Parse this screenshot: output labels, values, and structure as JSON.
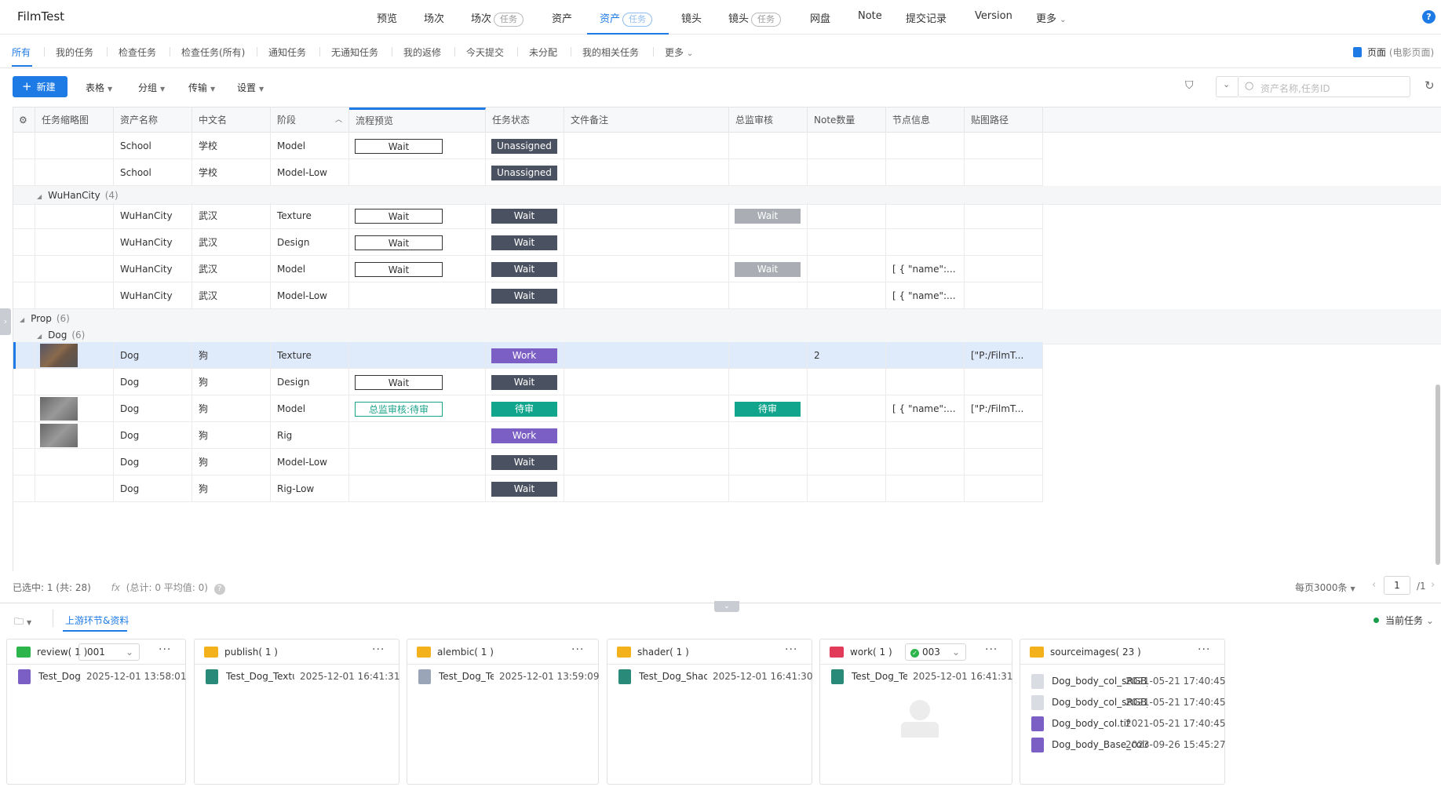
{
  "app_title": "FilmTest",
  "nav": [
    {
      "label": "预览",
      "pill": ""
    },
    {
      "label": "场次",
      "pill": ""
    },
    {
      "label": "场次",
      "pill": "任务"
    },
    {
      "label": "资产",
      "pill": ""
    },
    {
      "label": "资产",
      "pill": "任务"
    },
    {
      "label": "镜头",
      "pill": ""
    },
    {
      "label": "镜头",
      "pill": "任务"
    },
    {
      "label": "网盘",
      "pill": ""
    },
    {
      "label": "Note",
      "pill": ""
    },
    {
      "label": "提交记录",
      "pill": ""
    },
    {
      "label": "Version",
      "pill": ""
    },
    {
      "label": "更多",
      "pill": ""
    }
  ],
  "subtabs": [
    "所有",
    "我的任务",
    "检查任务",
    "检查任务(所有)",
    "通知任务",
    "无通知任务",
    "我的返修",
    "今天提交",
    "未分配",
    "我的相关任务",
    "更多"
  ],
  "page_label": "页面",
  "page_context": "(电影页面)",
  "toolbar": {
    "new_label": "新建",
    "menus": [
      "表格",
      "分组",
      "传输",
      "设置"
    ],
    "search_placeholder": "资产名称,任务ID"
  },
  "columns": [
    "任务缩略图",
    "资产名称",
    "中文名",
    "阶段",
    "流程预览",
    "任务状态",
    "文件备注",
    "总监审核",
    "Note数量",
    "节点信息",
    "贴图路径"
  ],
  "school_rows": [
    {
      "asset": "School",
      "cn": "学校",
      "stage": "Model",
      "flow": "Wait",
      "status": "Unassigned",
      "review": "",
      "notes": "",
      "node": "",
      "path": ""
    },
    {
      "asset": "School",
      "cn": "学校",
      "stage": "Model-Low",
      "flow": "",
      "status": "Unassigned",
      "review": "",
      "notes": "",
      "node": "",
      "path": ""
    }
  ],
  "group_wuhan": {
    "name": "WuHanCity",
    "count": "(4)"
  },
  "wuhan_rows": [
    {
      "asset": "WuHanCity",
      "cn": "武汉",
      "stage": "Texture",
      "flow": "Wait",
      "status": "Wait",
      "review": "Wait",
      "notes": "",
      "node": "",
      "path": ""
    },
    {
      "asset": "WuHanCity",
      "cn": "武汉",
      "stage": "Design",
      "flow": "Wait",
      "status": "Wait",
      "review": "",
      "notes": "",
      "node": "",
      "path": ""
    },
    {
      "asset": "WuHanCity",
      "cn": "武汉",
      "stage": "Model",
      "flow": "Wait",
      "status": "Wait",
      "review": "Wait",
      "notes": "",
      "node": "[ { \"name\":...",
      "path": ""
    },
    {
      "asset": "WuHanCity",
      "cn": "武汉",
      "stage": "Model-Low",
      "flow": "",
      "status": "Wait",
      "review": "",
      "notes": "",
      "node": "[ { \"name\":...",
      "path": ""
    }
  ],
  "group_prop": {
    "name": "Prop",
    "count": "(6)"
  },
  "group_dog": {
    "name": "Dog",
    "count": "(6)"
  },
  "dog_rows": [
    {
      "asset": "Dog",
      "cn": "狗",
      "stage": "Texture",
      "flow": "",
      "status": "Work",
      "review": "",
      "notes": "2",
      "node": "",
      "path": "[\"P:/FilmT..."
    },
    {
      "asset": "Dog",
      "cn": "狗",
      "stage": "Design",
      "flow": "Wait",
      "status": "Wait",
      "review": "",
      "notes": "",
      "node": "",
      "path": ""
    },
    {
      "asset": "Dog",
      "cn": "狗",
      "stage": "Model",
      "flow": "总监审核:待审",
      "status": "待审",
      "review": "待审",
      "notes": "",
      "node": "[ { \"name\":...",
      "path": "[\"P:/FilmT..."
    },
    {
      "asset": "Dog",
      "cn": "狗",
      "stage": "Rig",
      "flow": "",
      "status": "Work",
      "review": "",
      "notes": "",
      "node": "",
      "path": ""
    },
    {
      "asset": "Dog",
      "cn": "狗",
      "stage": "Model-Low",
      "flow": "",
      "status": "Wait",
      "review": "",
      "notes": "",
      "node": "",
      "path": ""
    },
    {
      "asset": "Dog",
      "cn": "狗",
      "stage": "Rig-Low",
      "flow": "",
      "status": "Wait",
      "review": "",
      "notes": "",
      "node": "",
      "path": ""
    }
  ],
  "status_bar": {
    "selected": "已选中: 1 (共: 28)",
    "formula": "(总计: 0 平均值: 0)"
  },
  "pagination": {
    "page_size": "每页3000条",
    "page": "1",
    "total": "/1"
  },
  "bottom": {
    "tab_label": "上游环节&资料",
    "current_task": "当前任务",
    "cards": [
      {
        "title": "review( 1 )",
        "dropdown": "001",
        "files": [
          {
            "name": "Test_Dog_Te...",
            "date": "2025-12-01 13:58:01"
          }
        ]
      },
      {
        "title": "publish( 1 )",
        "dropdown": "",
        "files": [
          {
            "name": "Test_Dog_Texture.ma",
            "date": "2025-12-01 16:41:31"
          }
        ]
      },
      {
        "title": "alembic( 1 )",
        "dropdown": "",
        "files": [
          {
            "name": "Test_Dog_Textu...",
            "date": "2025-12-01 13:59:09"
          }
        ]
      },
      {
        "title": "shader( 1 )",
        "dropdown": "",
        "files": [
          {
            "name": "Test_Dog_Shader.ma",
            "date": "2025-12-01 16:41:30"
          }
        ]
      },
      {
        "title": "work( 1 )",
        "dropdown": "003",
        "files": [
          {
            "name": "Test_Dog_Textu...",
            "date": "2025-12-01 16:41:31"
          }
        ]
      },
      {
        "title": "sourceimages( 23 )",
        "dropdown": "",
        "files": [
          {
            "name": "Dog_body_col_sRGB_...",
            "date": "2021-05-21 17:40:45"
          },
          {
            "name": "Dog_body_col_sRGB_...",
            "date": "2021-05-21 17:40:45"
          },
          {
            "name": "Dog_body_col.tif",
            "date": "2021-05-21 17:40:45"
          },
          {
            "name": "Dog_body_Base_color.tif",
            "date": "2023-09-26 15:45:27"
          }
        ]
      }
    ]
  },
  "colors": {
    "accent": "#1e7be6",
    "badge_dark": "#4a5160",
    "badge_purple": "#7b5fc4",
    "badge_green": "#12a58d",
    "badge_gray": "#aaadb3"
  }
}
